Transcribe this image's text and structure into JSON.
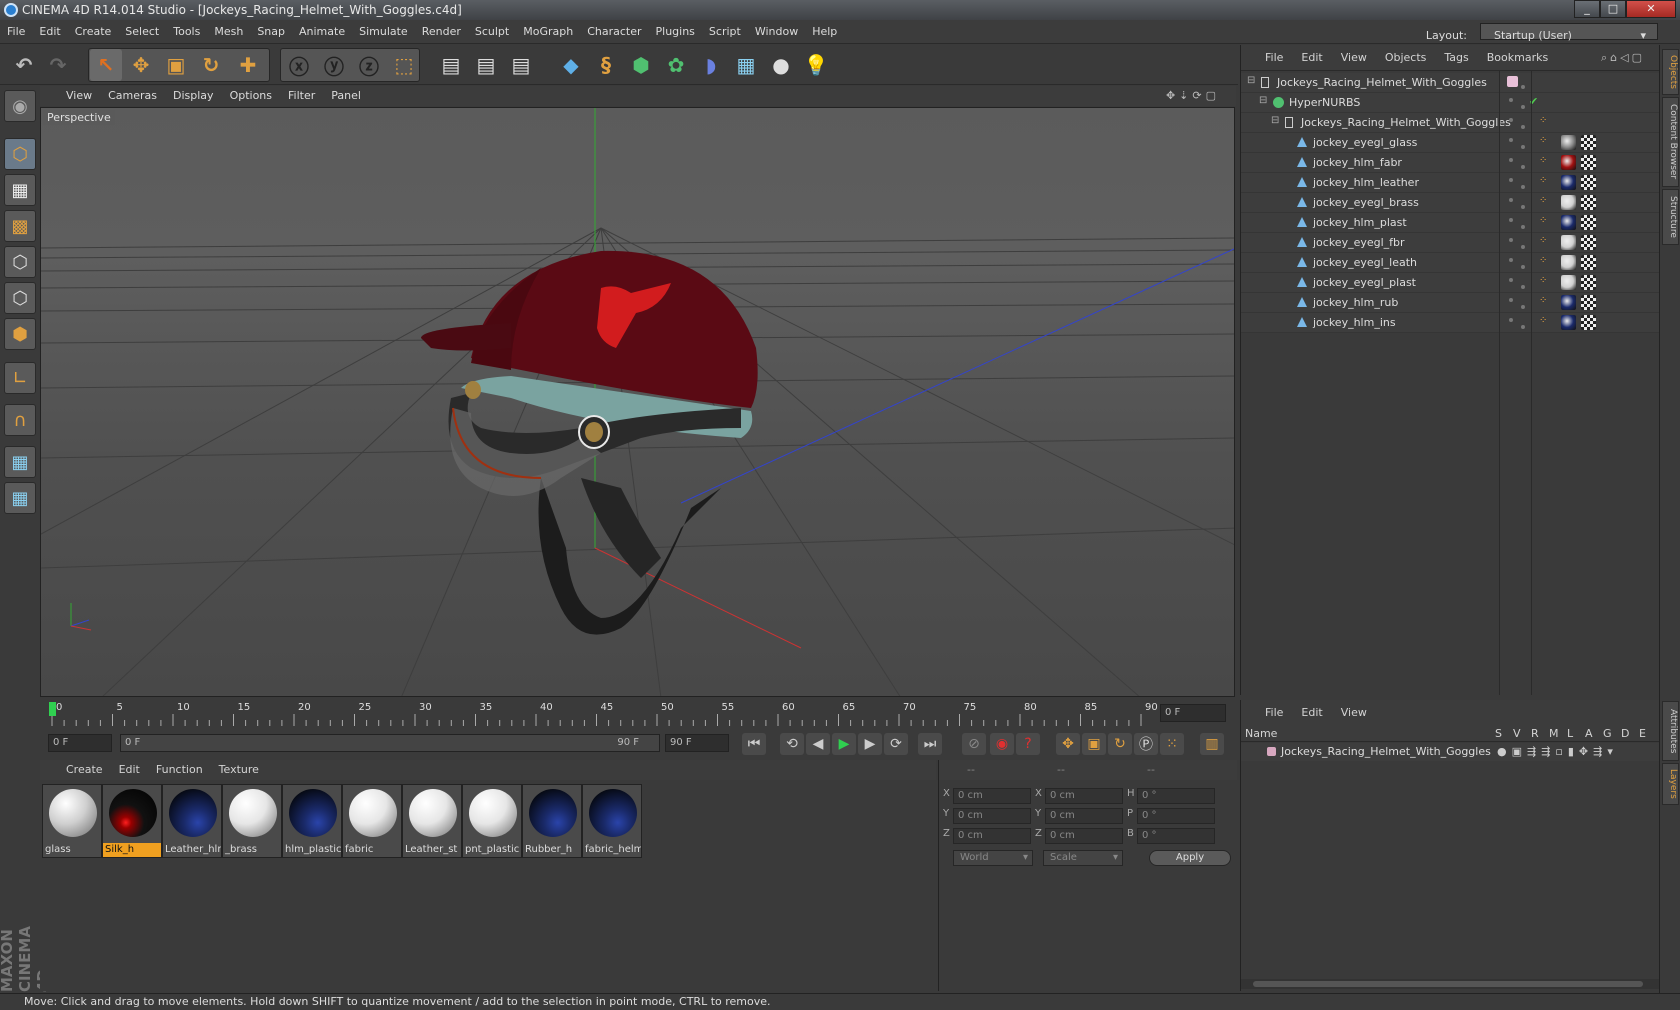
{
  "window": {
    "title": "CINEMA 4D R14.014 Studio - [Jockeys_Racing_Helmet_With_Goggles.c4d]",
    "minimize_label": "_",
    "maximize_label": "□",
    "close_label": "✕"
  },
  "menubar": {
    "items": [
      "File",
      "Edit",
      "Create",
      "Select",
      "Tools",
      "Mesh",
      "Snap",
      "Animate",
      "Simulate",
      "Render",
      "Sculpt",
      "MoGraph",
      "Character",
      "Plugins",
      "Script",
      "Window",
      "Help"
    ],
    "layout_label": "Layout:",
    "layout_value": "Startup (User)"
  },
  "viewport": {
    "menu": [
      "View",
      "Cameras",
      "Display",
      "Options",
      "Filter",
      "Panel"
    ],
    "label": "Perspective"
  },
  "timeline": {
    "ticks": [
      "0",
      "5",
      "10",
      "15",
      "20",
      "25",
      "30",
      "35",
      "40",
      "45",
      "50",
      "55",
      "60",
      "65",
      "70",
      "75",
      "80",
      "85",
      "90"
    ],
    "current_frame": "0 F"
  },
  "playback": {
    "start_field": "0 F",
    "range_start": "0 F",
    "range_end": "90 F",
    "end_field": "90 F"
  },
  "materials": {
    "menu": [
      "Create",
      "Edit",
      "Function",
      "Texture"
    ],
    "items": [
      {
        "name": "glass",
        "color": "#cfcfcf",
        "style": "white",
        "selected": false
      },
      {
        "name": "Silk_h",
        "color": "#cc1010",
        "style": "red",
        "selected": true
      },
      {
        "name": "Leather_hlr",
        "color": "#1a2a6a",
        "style": "blue",
        "selected": false
      },
      {
        "name": "_brass",
        "color": "#e6e6e6",
        "style": "white",
        "selected": false
      },
      {
        "name": "hlm_plastic",
        "color": "#1a2a6a",
        "style": "blue",
        "selected": false
      },
      {
        "name": "fabric",
        "color": "#e6e6e6",
        "style": "white",
        "selected": false
      },
      {
        "name": "Leather_st",
        "color": "#e6e6e6",
        "style": "white",
        "selected": false
      },
      {
        "name": "pnt_plastic",
        "color": "#e6e6e6",
        "style": "white",
        "selected": false
      },
      {
        "name": "Rubber_h",
        "color": "#1a2a6a",
        "style": "blue",
        "selected": false
      },
      {
        "name": "fabric_helm",
        "color": "#1a2a6a",
        "style": "blue",
        "selected": false
      }
    ]
  },
  "coordinates": {
    "headers": [
      "--",
      "--",
      "--"
    ],
    "rows": [
      {
        "a": "X",
        "av": "0 cm",
        "b": "X",
        "bv": "0 cm",
        "c": "H",
        "cv": "0 °"
      },
      {
        "a": "Y",
        "av": "0 cm",
        "b": "Y",
        "bv": "0 cm",
        "c": "P",
        "cv": "0 °"
      },
      {
        "a": "Z",
        "av": "0 cm",
        "b": "Z",
        "bv": "0 cm",
        "c": "B",
        "cv": "0 °"
      }
    ],
    "mode1": "World",
    "mode2": "Scale",
    "apply_label": "Apply"
  },
  "objects": {
    "menu": [
      "File",
      "Edit",
      "View",
      "Objects",
      "Tags",
      "Bookmarks"
    ],
    "tree": [
      {
        "label": "Jockeys_Racing_Helmet_With_Goggles",
        "level": 0,
        "type": "null"
      },
      {
        "label": "HyperNURBS",
        "level": 1,
        "type": "nurbs"
      },
      {
        "label": "Jockeys_Racing_Helmet_With_Goggles",
        "level": 2,
        "type": "null"
      },
      {
        "label": "jockey_eyegl_glass",
        "level": 3,
        "type": "mesh",
        "mat": "#8a8a8a"
      },
      {
        "label": "jockey_hlm_fabr",
        "level": 3,
        "type": "mesh",
        "mat": "#a01010"
      },
      {
        "label": "jockey_hlm_leather",
        "level": 3,
        "type": "mesh",
        "mat": "#1a2a6a"
      },
      {
        "label": "jockey_eyegl_brass",
        "level": 3,
        "type": "mesh",
        "mat": "#d0d0d0"
      },
      {
        "label": "jockey_hlm_plast",
        "level": 3,
        "type": "mesh",
        "mat": "#1a2a6a"
      },
      {
        "label": "jockey_eyegl_fbr",
        "level": 3,
        "type": "mesh",
        "mat": "#d0d0d0"
      },
      {
        "label": "jockey_eyegl_leath",
        "level": 3,
        "type": "mesh",
        "mat": "#d0d0d0"
      },
      {
        "label": "jockey_eyegl_plast",
        "level": 3,
        "type": "mesh",
        "mat": "#d0d0d0"
      },
      {
        "label": "jockey_hlm_rub",
        "level": 3,
        "type": "mesh",
        "mat": "#1a2a6a"
      },
      {
        "label": "jockey_hlm_ins",
        "level": 3,
        "type": "mesh",
        "mat": "#1a2a6a"
      }
    ]
  },
  "layers": {
    "menu": [
      "File",
      "Edit",
      "View"
    ],
    "col_name": "Name",
    "col_flags": [
      "S",
      "V",
      "R",
      "M",
      "L",
      "A",
      "G",
      "D",
      "E"
    ],
    "row_label": "Jockeys_Racing_Helmet_With_Goggles"
  },
  "right_tabs": [
    "Objects",
    "Content Browser",
    "Structure",
    "Attributes",
    "Layers"
  ],
  "status": "Move: Click and drag to move elements. Hold down SHIFT to quantize movement / add to the selection in point mode, CTRL to remove.",
  "colors": {
    "accent": "#e0a040",
    "axis_x": "#cc3333",
    "axis_y": "#33aa33",
    "axis_z": "#3344cc",
    "helmet": "#5a0a14"
  }
}
